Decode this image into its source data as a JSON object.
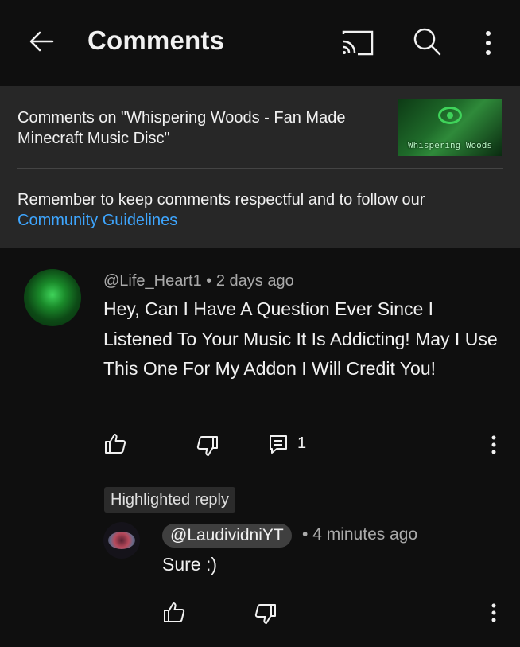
{
  "header": {
    "title": "Comments",
    "icons": [
      "back-arrow-icon",
      "cast-icon",
      "search-icon",
      "more-vertical-icon"
    ]
  },
  "info_panel": {
    "comments_on": "Comments on \"Whispering Woods - Fan Made Minecraft Music Disc\"",
    "thumbnail_text": "Whispering Woods",
    "guidelines_text": "Remember to keep comments respectful and to follow our",
    "guidelines_link": "Community Guidelines"
  },
  "comment": {
    "author": "@Life_Heart1",
    "separator": "•",
    "time": "2 days ago",
    "text": "Hey, Can I Have A Question Ever Since I Listened To Your Music It Is Addicting! May I Use This One For My Addon I Will Credit You!",
    "reply_count": "1"
  },
  "reply": {
    "badge": "Highlighted reply",
    "author": "@LaudividniYT",
    "separator": "•",
    "time": "4 minutes ago",
    "text": "Sure :)"
  },
  "colors": {
    "background": "#0f0f0f",
    "panel": "#272727",
    "link": "#3ea6ff",
    "secondary_text": "#aaaaaa"
  }
}
